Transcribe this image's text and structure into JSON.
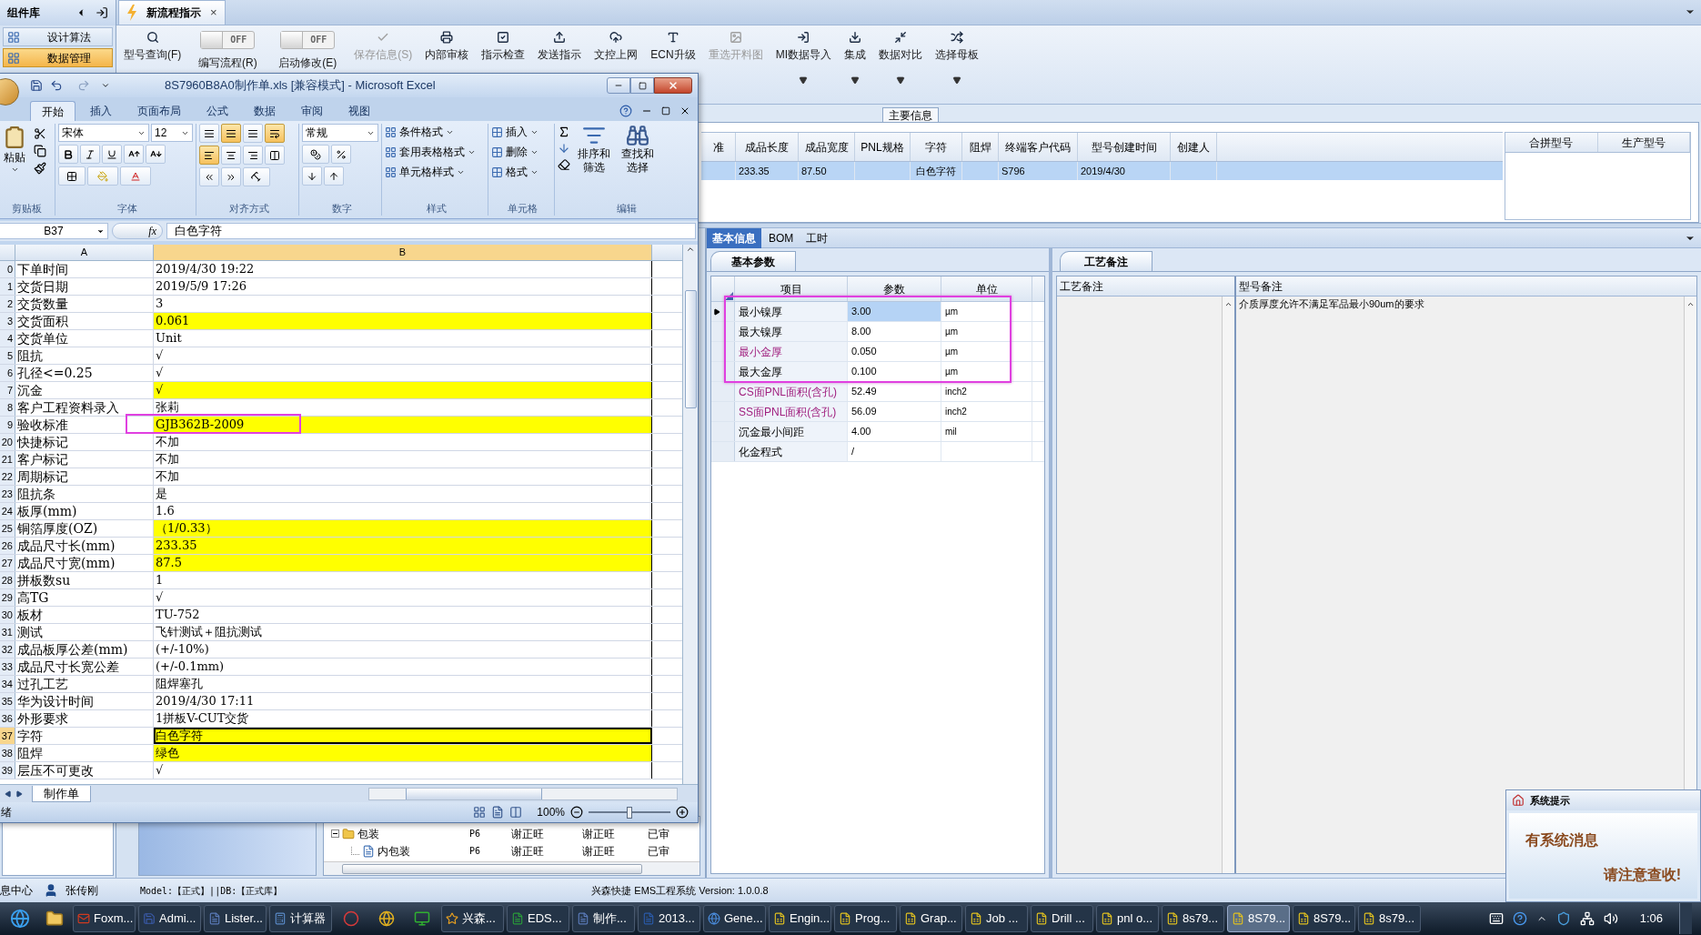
{
  "sidebar": {
    "title": "组件库",
    "items": [
      {
        "label": "设计算法",
        "selected": false
      },
      {
        "label": "数据管理",
        "selected": true
      }
    ]
  },
  "doc_tab": {
    "title": "新流程指示",
    "close": "×"
  },
  "toolbar": [
    {
      "kind": "button",
      "label": "型号查询(F)",
      "disabled": false,
      "dropdown": false
    },
    {
      "kind": "toggle",
      "label": "编写流程(R)",
      "state": "OFF",
      "on": false
    },
    {
      "kind": "toggle",
      "label": "启动修改(E)",
      "state": "OFF",
      "on": false
    },
    {
      "kind": "button",
      "label": "保存信息(S)",
      "disabled": true,
      "dropdown": false
    },
    {
      "kind": "button",
      "label": "内部审核",
      "disabled": false,
      "dropdown": false
    },
    {
      "kind": "button",
      "label": "指示检查",
      "disabled": false,
      "dropdown": false
    },
    {
      "kind": "button",
      "label": "发送指示",
      "disabled": false,
      "dropdown": false
    },
    {
      "kind": "button",
      "label": "文控上网",
      "disabled": false,
      "dropdown": false
    },
    {
      "kind": "button",
      "label": "ECN升级",
      "disabled": false,
      "dropdown": false
    },
    {
      "kind": "button",
      "label": "重选开料图",
      "disabled": true,
      "dropdown": false
    },
    {
      "kind": "button",
      "label": "MI数据导入",
      "disabled": false,
      "dropdown": true
    },
    {
      "kind": "button",
      "label": "集成",
      "disabled": false,
      "dropdown": true
    },
    {
      "kind": "button",
      "label": "数据对比",
      "disabled": false,
      "dropdown": true
    },
    {
      "kind": "button",
      "label": "选择母板",
      "disabled": false,
      "dropdown": true
    }
  ],
  "main_info": {
    "title": "主要信息",
    "columns": [
      "准",
      "成品长度",
      "成品宽度",
      "PNL规格",
      "字符",
      "阻焊",
      "终端客户代码",
      "型号创建时间",
      "创建人"
    ],
    "rows": [
      {
        "selected": true,
        "cells": [
          null,
          "233.35",
          "87.50",
          null,
          "白色字符",
          null,
          "S796",
          "2019/4/30",
          null
        ]
      }
    ],
    "side_columns": [
      "合拼型号",
      "生产型号"
    ]
  },
  "detail_tabs": [
    {
      "label": "基本信息",
      "selected": true
    },
    {
      "label": "BOM",
      "selected": false
    },
    {
      "label": "工时",
      "selected": false
    }
  ],
  "params": {
    "tab": "基本参数",
    "columns": [
      "项目",
      "参数",
      "单位"
    ],
    "rows": [
      {
        "name": "最小镍厚",
        "value": "3.00",
        "unit": "µm",
        "flagged": false,
        "selected": true,
        "marked": true
      },
      {
        "name": "最大镍厚",
        "value": "8.00",
        "unit": "µm",
        "flagged": false,
        "selected": false,
        "marked": true
      },
      {
        "name": "最小金厚",
        "value": "0.050",
        "unit": "µm",
        "flagged": true,
        "selected": false,
        "marked": true
      },
      {
        "name": "最大金厚",
        "value": "0.100",
        "unit": "µm",
        "flagged": false,
        "selected": false,
        "marked": true
      },
      {
        "name": "CS面PNL面积(含孔)",
        "value": "52.49",
        "unit": "inch2",
        "flagged": true,
        "selected": false,
        "marked": false
      },
      {
        "name": "SS面PNL面积(含孔)",
        "value": "56.09",
        "unit": "inch2",
        "flagged": true,
        "selected": false,
        "marked": false
      },
      {
        "name": "沉金最小间距",
        "value": "4.00",
        "unit": "mil",
        "flagged": false,
        "selected": false,
        "marked": false
      },
      {
        "name": "化金程式",
        "value": "/",
        "unit": null,
        "flagged": false,
        "selected": false,
        "marked": false
      }
    ]
  },
  "notes": {
    "tab": "工艺备注",
    "columns": [
      "工艺备注",
      "型号备注"
    ],
    "model_note": "介质厚度允许不满足军品最小90um的要求"
  },
  "tree": [
    {
      "label": "包装",
      "expanded": true,
      "cells": [
        "P6",
        "谢正旺",
        "谢正旺",
        "已审"
      ],
      "children": [
        {
          "label": "内包装",
          "cells": [
            "P6",
            "谢正旺",
            "谢正旺",
            "已审"
          ]
        }
      ]
    }
  ],
  "excel": {
    "title": "8S7960B8A0制作单.xls  [兼容模式] - Microsoft Excel",
    "tabs": [
      {
        "label": "开始",
        "selected": true
      },
      {
        "label": "插入",
        "selected": false
      },
      {
        "label": "页面布局",
        "selected": false
      },
      {
        "label": "公式",
        "selected": false
      },
      {
        "label": "数据",
        "selected": false
      },
      {
        "label": "审阅",
        "selected": false
      },
      {
        "label": "视图",
        "selected": false
      }
    ],
    "clipboard": {
      "label": "剪贴板",
      "paste": "粘贴"
    },
    "font": {
      "label": "字体",
      "name": "宋体",
      "size": "12"
    },
    "alignment": {
      "label": "对齐方式",
      "buttons": [
        {
          "selected": false
        },
        {
          "selected": true
        },
        {
          "selected": false
        },
        {
          "selected": true
        },
        {
          "selected": true
        },
        {
          "selected": false
        },
        {
          "selected": false
        },
        {
          "selected": false
        }
      ]
    },
    "number": {
      "label": "数字",
      "format": "常规"
    },
    "styles": {
      "label": "样式",
      "items": [
        "条件格式",
        "套用表格格式",
        "单元格样式"
      ]
    },
    "cells": {
      "label": "单元格",
      "items": [
        "插入",
        "删除",
        "格式"
      ]
    },
    "editing": {
      "label": "编辑",
      "items": [
        "排序和筛选",
        "查找和选择"
      ]
    },
    "name_box": "B37",
    "fx": "fx",
    "formula": "白色字符",
    "columns": [
      "A",
      "B"
    ],
    "rows": [
      {
        "number": "0",
        "label": "下单时间",
        "value": "2019/4/30 19:22",
        "filled": false,
        "marked": false,
        "selected": false
      },
      {
        "number": "1",
        "label": "交货日期",
        "value": "2019/5/9 17:26",
        "filled": false,
        "marked": false,
        "selected": false
      },
      {
        "number": "2",
        "label": "交货数量",
        "value": "3",
        "filled": false,
        "marked": false,
        "selected": false
      },
      {
        "number": "3",
        "label": "交货面积",
        "value": "0.061",
        "filled": true,
        "marked": false,
        "selected": false
      },
      {
        "number": "4",
        "label": "交货单位",
        "value": "Unit",
        "filled": false,
        "marked": false,
        "selected": false
      },
      {
        "number": "5",
        "label": "阻抗",
        "value": "√",
        "filled": false,
        "marked": false,
        "selected": false
      },
      {
        "number": "6",
        "label": "孔径<=0.25",
        "value": "√",
        "filled": false,
        "marked": false,
        "selected": false
      },
      {
        "number": "7",
        "label": "沉金",
        "value": "√",
        "filled": true,
        "marked": false,
        "selected": false
      },
      {
        "number": "8",
        "label": "客户工程资料录入",
        "value": "张莉",
        "filled": false,
        "marked": false,
        "selected": false
      },
      {
        "number": "9",
        "label": "验收标准",
        "value": "GJB362B-2009",
        "filled": true,
        "marked": true,
        "selected": false
      },
      {
        "number": "20",
        "label": "快捷标记",
        "value": "不加",
        "filled": false,
        "marked": false,
        "selected": false
      },
      {
        "number": "21",
        "label": "客户标记",
        "value": "不加",
        "filled": false,
        "marked": false,
        "selected": false
      },
      {
        "number": "22",
        "label": "周期标记",
        "value": "不加",
        "filled": false,
        "marked": false,
        "selected": false
      },
      {
        "number": "23",
        "label": "阻抗条",
        "value": "是",
        "filled": false,
        "marked": false,
        "selected": false
      },
      {
        "number": "24",
        "label": "板厚(mm)",
        "value": "1.6",
        "filled": false,
        "marked": false,
        "selected": false
      },
      {
        "number": "25",
        "label": "铜箔厚度(OZ)",
        "value": "（1/0.33）",
        "filled": true,
        "marked": false,
        "selected": false
      },
      {
        "number": "26",
        "label": "成品尺寸长(mm)",
        "value": "233.35",
        "filled": true,
        "marked": false,
        "selected": false
      },
      {
        "number": "27",
        "label": "成品尺寸宽(mm)",
        "value": "87.5",
        "filled": true,
        "marked": false,
        "selected": false
      },
      {
        "number": "28",
        "label": "拼板数su",
        "value": "1",
        "filled": false,
        "marked": false,
        "selected": false
      },
      {
        "number": "29",
        "label": "高TG",
        "value": "√",
        "filled": false,
        "marked": false,
        "selected": false
      },
      {
        "number": "30",
        "label": "板材",
        "value": "TU-752",
        "filled": false,
        "marked": false,
        "selected": false
      },
      {
        "number": "31",
        "label": "测试",
        "value": "飞针测试＋阻抗测试",
        "filled": false,
        "marked": false,
        "selected": false
      },
      {
        "number": "32",
        "label": "成品板厚公差(mm)",
        "value": "(+/-10%)",
        "filled": false,
        "marked": false,
        "selected": false
      },
      {
        "number": "33",
        "label": "成品尺寸长宽公差",
        "value": "(+/-0.1mm)",
        "filled": false,
        "marked": false,
        "selected": false
      },
      {
        "number": "34",
        "label": "过孔工艺",
        "value": "阻焊塞孔",
        "filled": false,
        "marked": false,
        "selected": false
      },
      {
        "number": "35",
        "label": "华为设计时间",
        "value": "2019/4/30 17:11",
        "filled": false,
        "marked": false,
        "selected": false
      },
      {
        "number": "36",
        "label": "外形要求",
        "value": "1拼板V-CUT交货",
        "filled": false,
        "marked": false,
        "selected": false
      },
      {
        "number": "37",
        "label": "字符",
        "value": "白色字符",
        "filled": true,
        "marked": false,
        "selected": true
      },
      {
        "number": "38",
        "label": "阻焊",
        "value": "绿色",
        "filled": true,
        "marked": false,
        "selected": false
      },
      {
        "number": "39",
        "label": "层压不可更改",
        "value": "√",
        "filled": false,
        "marked": false,
        "selected": false
      }
    ],
    "sheet_tab": "制作单",
    "status": "绪",
    "zoom": "100%",
    "zoom_slider": {
      "level": 0.5
    }
  },
  "status_bar": {
    "module": "息中心",
    "user": "张传刚",
    "model": "Model:【正式】||DB:【正式库】",
    "system": "兴森快捷 EMS工程系统 Version: 1.0.0.8"
  },
  "taskbar": {
    "items": [
      {
        "kind": "launcher"
      },
      {
        "kind": "launcher"
      },
      {
        "kind": "app",
        "label": "Foxm...",
        "selected": false
      },
      {
        "kind": "app",
        "label": "Admi...",
        "selected": false
      },
      {
        "kind": "app",
        "label": "Lister...",
        "selected": false
      },
      {
        "kind": "app",
        "label": "计算器",
        "selected": false
      },
      {
        "kind": "icon"
      },
      {
        "kind": "icon"
      },
      {
        "kind": "icon"
      },
      {
        "kind": "app",
        "label": "兴森...",
        "selected": false
      },
      {
        "kind": "app",
        "label": "EDS...",
        "selected": false
      },
      {
        "kind": "app",
        "label": "制作...",
        "selected": false
      },
      {
        "kind": "app",
        "label": "2013...",
        "selected": false
      },
      {
        "kind": "app",
        "label": "Gene...",
        "selected": false
      },
      {
        "kind": "app",
        "label": "Engin...",
        "selected": false
      },
      {
        "kind": "app",
        "label": "Prog...",
        "selected": false
      },
      {
        "kind": "app",
        "label": "Grap...",
        "selected": false
      },
      {
        "kind": "app",
        "label": "Job ...",
        "selected": false
      },
      {
        "kind": "app",
        "label": "Drill ...",
        "selected": false
      },
      {
        "kind": "app",
        "label": "pnl o...",
        "selected": false
      },
      {
        "kind": "app",
        "label": "8s79...",
        "selected": false
      },
      {
        "kind": "app",
        "label": "8S79...",
        "selected": true
      },
      {
        "kind": "app",
        "label": "8S79...",
        "selected": false
      },
      {
        "kind": "app",
        "label": "8s79...",
        "selected": false
      }
    ],
    "clock": "1:06"
  },
  "popup": {
    "title": "系统提示",
    "line1": "有系统消息",
    "line2": "请注意查收!"
  }
}
